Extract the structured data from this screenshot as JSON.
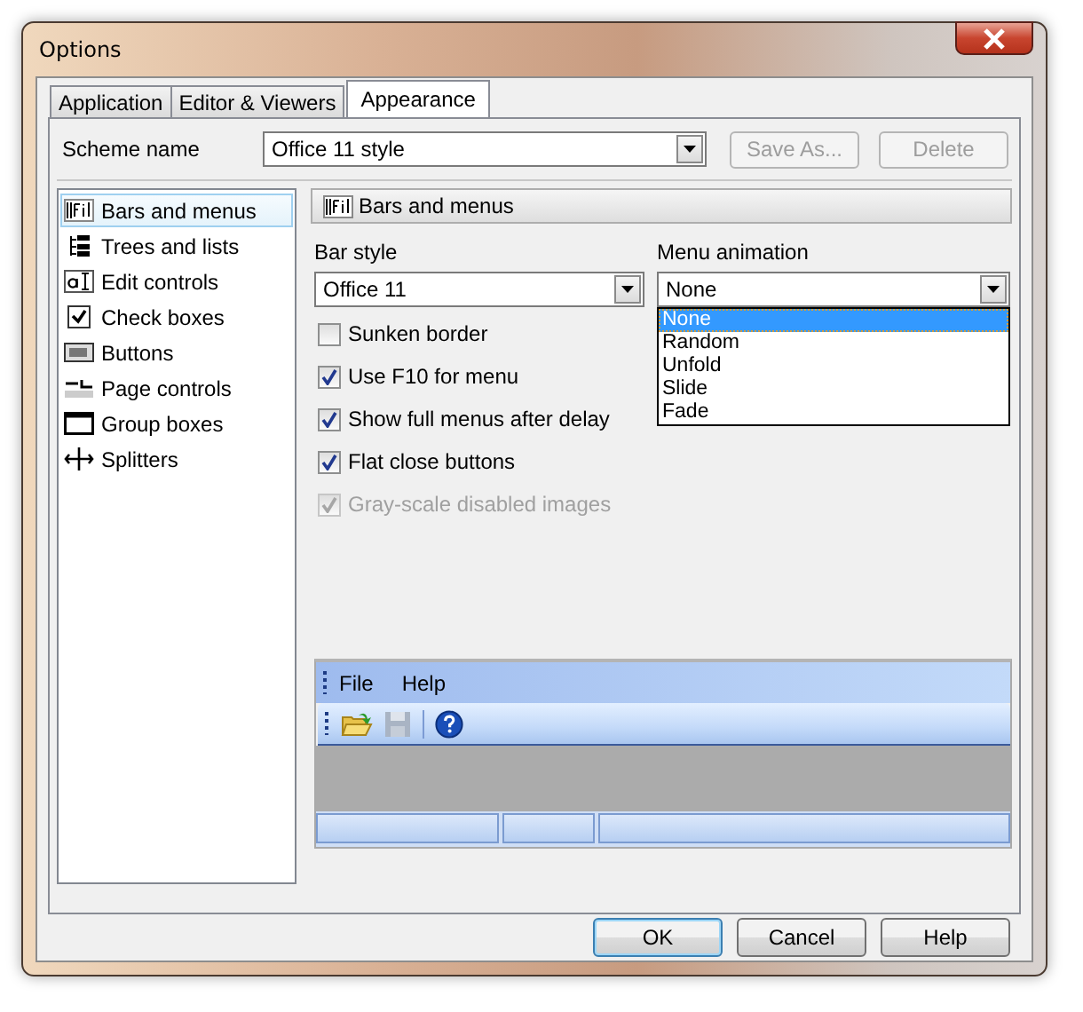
{
  "window": {
    "title": "Options"
  },
  "tabs": [
    {
      "label": "Application",
      "selected": false
    },
    {
      "label": "Editor & Viewers",
      "selected": false
    },
    {
      "label": "Appearance",
      "selected": true
    }
  ],
  "scheme": {
    "label": "Scheme name",
    "value": "Office 11 style",
    "buttons": [
      {
        "label": "Save As...",
        "disabled": true
      },
      {
        "label": "Delete",
        "disabled": true
      }
    ]
  },
  "categories": [
    {
      "label": "Bars and menus",
      "selected": true
    },
    {
      "label": "Trees and lists",
      "selected": false
    },
    {
      "label": "Edit controls",
      "selected": false
    },
    {
      "label": "Check boxes",
      "selected": false
    },
    {
      "label": "Buttons",
      "selected": false
    },
    {
      "label": "Page controls",
      "selected": false
    },
    {
      "label": "Group boxes",
      "selected": false
    },
    {
      "label": "Splitters",
      "selected": false
    }
  ],
  "section_title": "Bars and menus",
  "bar_style": {
    "label": "Bar style",
    "value": "Office 11"
  },
  "menu_animation": {
    "label": "Menu animation",
    "value": "None",
    "expanded": true,
    "options": [
      {
        "label": "None",
        "selected": true
      },
      {
        "label": "Random",
        "selected": false
      },
      {
        "label": "Unfold",
        "selected": false
      },
      {
        "label": "Slide",
        "selected": false
      },
      {
        "label": "Fade",
        "selected": false
      }
    ]
  },
  "checkboxes": [
    {
      "label": "Sunken border",
      "checked": false,
      "disabled": false
    },
    {
      "label": "Use F10 for menu",
      "checked": true,
      "disabled": false
    },
    {
      "label": "Show full menus after delay",
      "checked": true,
      "disabled": false
    },
    {
      "label": "Flat close buttons",
      "checked": true,
      "disabled": false
    },
    {
      "label": "Gray-scale disabled images",
      "checked": true,
      "disabled": true
    }
  ],
  "preview": {
    "menus": [
      "File",
      "Help"
    ]
  },
  "buttons": [
    {
      "label": "OK",
      "default": true
    },
    {
      "label": "Cancel",
      "default": false
    },
    {
      "label": "Help",
      "default": false
    }
  ]
}
